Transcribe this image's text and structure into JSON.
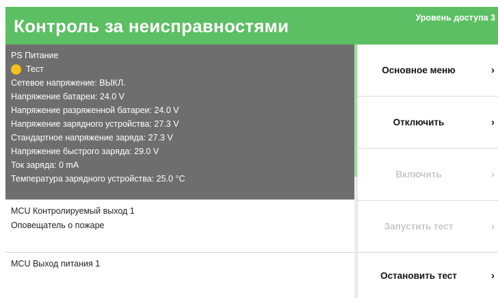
{
  "header": {
    "title": "Контроль за неисправностями",
    "access_level": "Уровень доступа 3"
  },
  "colors": {
    "header_bg": "#5cbf63",
    "selected_bg": "#6e6e6e",
    "status_dot": "#f2c21b",
    "disabled_text": "#c8c8c8"
  },
  "faults": [
    {
      "title": "PS Питание",
      "status": "Тест",
      "lines": [
        "Сетевое напряжение: ВЫКЛ.",
        "Напряжение батареи: 24.0 V",
        "Напряжение разряженной батареи: 24.0 V",
        "Напряжение зарядного устройства: 27.3 V",
        "Стандартное напряжение заряда: 27.3 V",
        "Напряжение быстрого заряда: 29.0 V",
        "Ток заряда: 0 mA",
        "Температура зарядного устройства: 25.0 °C"
      ]
    },
    {
      "title": "MCU Контролируемый выход 1",
      "lines": [
        "Оповещатель о пожаре"
      ]
    },
    {
      "title": "MCU Выход питания 1"
    }
  ],
  "menu": {
    "main_menu": "Основное меню",
    "disable": "Отключить",
    "enable": "Включить",
    "start_test": "Запустить тест",
    "stop_test": "Остановить тест",
    "chevron": "›"
  }
}
